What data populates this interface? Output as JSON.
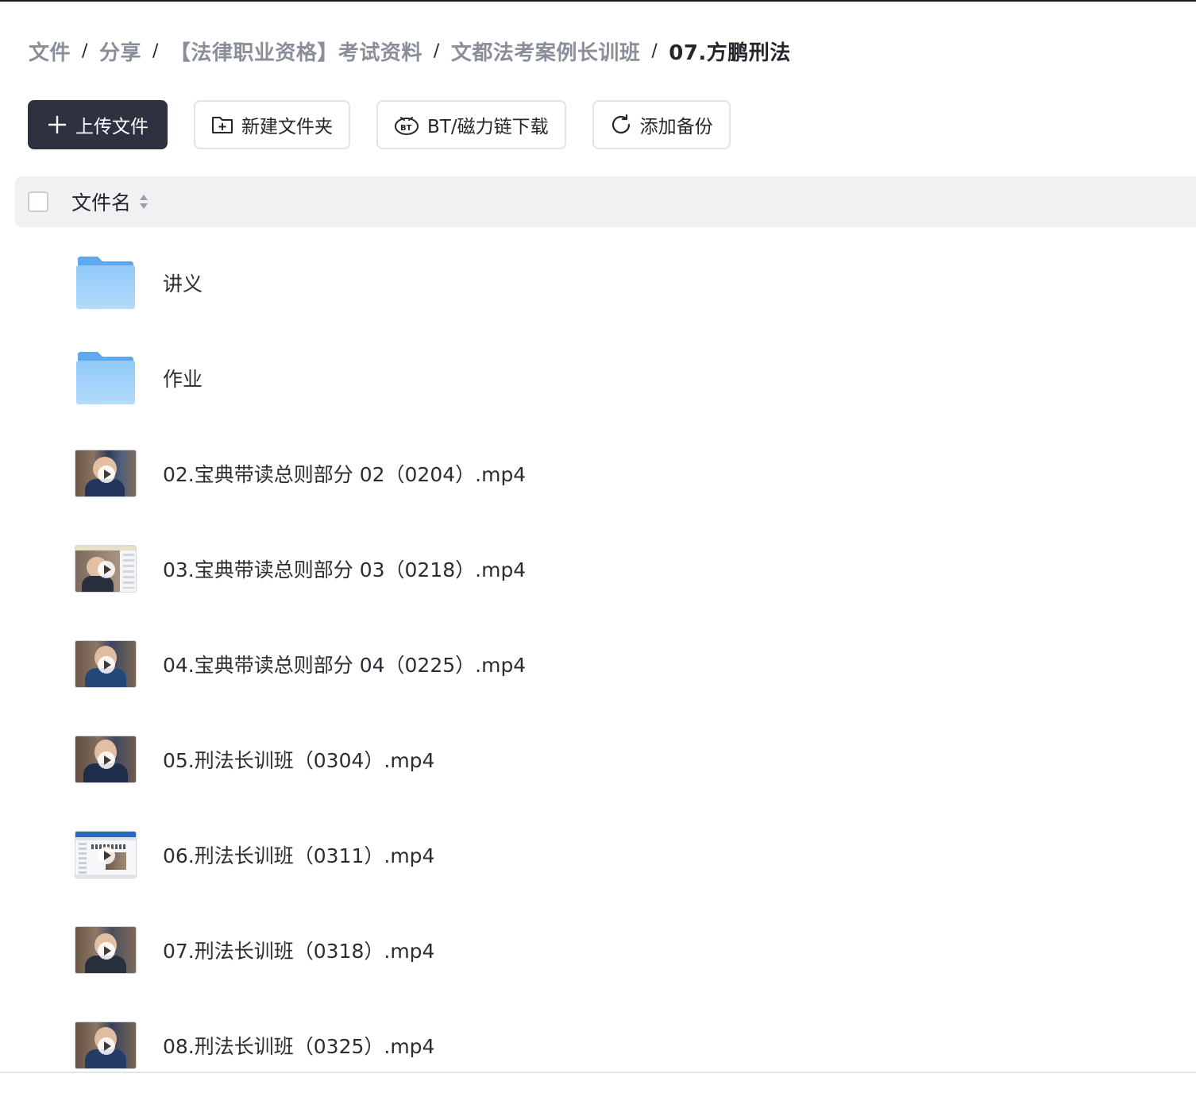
{
  "breadcrumb": [
    {
      "label": "文件"
    },
    {
      "label": "分享"
    },
    {
      "label": "【法律职业资格】考试资料"
    },
    {
      "label": "文都法考案例长训班"
    },
    {
      "label": "07.方鹏刑法"
    }
  ],
  "toolbar": {
    "upload_label": "上传文件",
    "new_folder_label": "新建文件夹",
    "bt_label": "BT/磁力链下载",
    "backup_label": "添加备份"
  },
  "list_header": {
    "name_column": "文件名"
  },
  "files": [
    {
      "name": "讲义",
      "type": "folder"
    },
    {
      "name": "作业",
      "type": "folder"
    },
    {
      "name": "02.宝典带读总则部分 02（0204）.mp4",
      "type": "video"
    },
    {
      "name": "03.宝典带读总则部分 03（0218）.mp4",
      "type": "video"
    },
    {
      "name": "04.宝典带读总则部分 04（0225）.mp4",
      "type": "video"
    },
    {
      "name": "05.刑法长训班（0304）.mp4",
      "type": "video"
    },
    {
      "name": "06.刑法长训班（0311）.mp4",
      "type": "video"
    },
    {
      "name": "07.刑法长训班（0318）.mp4",
      "type": "video"
    },
    {
      "name": "08.刑法长训班（0325）.mp4",
      "type": "video"
    }
  ],
  "colors": {
    "primary_button": "#2e3140",
    "folder": "#74b6f2",
    "header_bg": "#f0f1f3",
    "breadcrumb_muted": "#8a8e99"
  }
}
